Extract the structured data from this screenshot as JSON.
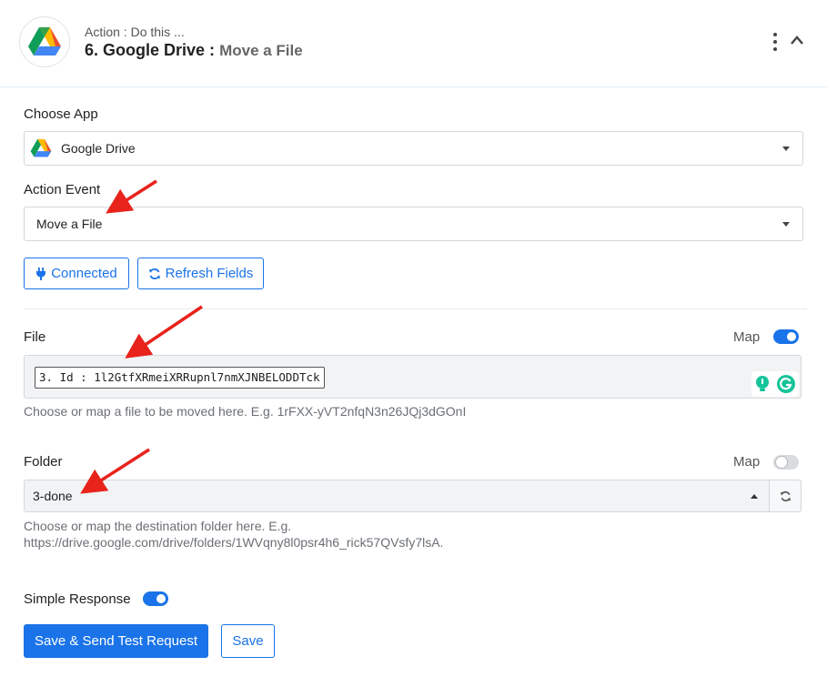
{
  "header": {
    "subtitle": "Action : Do this ...",
    "step": "6. Google Drive :",
    "action_name": "Move a File",
    "logo_icon": "google-drive-icon"
  },
  "choose_app": {
    "label": "Choose App",
    "value": "Google Drive"
  },
  "action_event": {
    "label": "Action Event",
    "value": "Move a File"
  },
  "buttons": {
    "connected": "Connected",
    "refresh_fields": "Refresh Fields"
  },
  "file": {
    "label": "File",
    "map_label": "Map",
    "map_enabled": true,
    "token": "3. Id : 1l2GtfXRmeiXRRupnl7nmXJNBELODDTck",
    "help": "Choose or map a file to be moved here. E.g. 1rFXX-yVT2nfqN3n26JQj3dGOnI"
  },
  "folder": {
    "label": "Folder",
    "map_label": "Map",
    "map_enabled": false,
    "value": "3-done",
    "help_line1": "Choose or map the destination folder here. E.g.",
    "help_line2": "https://drive.google.com/drive/folders/1WVqny8l0psr4h6_rick57QVsfy7lsA."
  },
  "simple_response": {
    "label": "Simple Response",
    "enabled": true
  },
  "actions": {
    "save_send": "Save & Send Test Request",
    "save": "Save"
  },
  "colors": {
    "primary": "#1a73e8",
    "annotation_arrow": "#e8231c"
  }
}
